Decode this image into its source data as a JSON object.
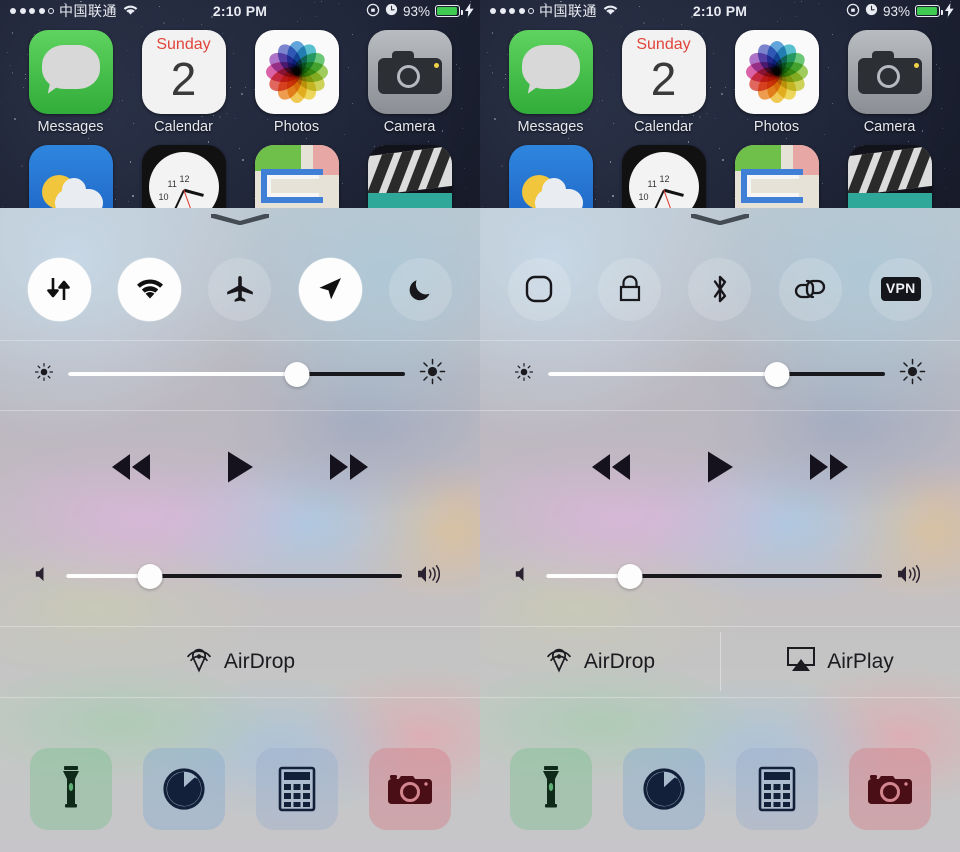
{
  "screens": [
    {
      "id": "left",
      "panel": "page-1"
    },
    {
      "id": "right",
      "panel": "page-2"
    }
  ],
  "status_bar": {
    "signal_dots_filled": 4,
    "signal_dots_total": 5,
    "carrier": "中国联通",
    "wifi_icon": "wifi-icon",
    "time": "2:10 PM",
    "rotation_lock_icon": "rotation-lock-icon",
    "alarm_icon": "alarm-clock-icon",
    "battery_percent": "93%",
    "battery_fill": 88,
    "battery_color": "#3fca52",
    "charging_icon": "lightning-bolt-icon"
  },
  "home_screen": {
    "rows": [
      [
        {
          "label": "Messages",
          "icon": "messages-icon"
        },
        {
          "label": "Calendar",
          "icon": "calendar-icon",
          "weekday": "Sunday",
          "date": "2"
        },
        {
          "label": "Photos",
          "icon": "photos-icon"
        },
        {
          "label": "Camera",
          "icon": "camera-icon"
        }
      ],
      [
        {
          "label": "Weather",
          "icon": "weather-icon"
        },
        {
          "label": "Clock",
          "icon": "clock-icon",
          "marks": [
            "10",
            "11",
            "12"
          ]
        },
        {
          "label": "Maps",
          "icon": "maps-icon"
        },
        {
          "label": "Videos",
          "icon": "videos-icon"
        }
      ]
    ]
  },
  "control_center": {
    "grabber": "grabber-handle",
    "left_toggles": [
      {
        "name": "cellular-data-toggle",
        "icon": "cellular-data-icon",
        "state": "on"
      },
      {
        "name": "wifi-toggle",
        "icon": "wifi-icon",
        "state": "on"
      },
      {
        "name": "airplane-mode-toggle",
        "icon": "airplane-icon",
        "state": "off"
      },
      {
        "name": "location-toggle",
        "icon": "location-arrow-icon",
        "state": "on"
      },
      {
        "name": "do-not-disturb-toggle",
        "icon": "moon-icon",
        "state": "off"
      }
    ],
    "right_toggles": [
      {
        "name": "assistive-touch-toggle",
        "icon": "rounded-square-icon",
        "state": "off"
      },
      {
        "name": "rotation-lock-toggle",
        "icon": "padlock-icon",
        "state": "off"
      },
      {
        "name": "bluetooth-toggle",
        "icon": "bluetooth-icon",
        "state": "off"
      },
      {
        "name": "personal-hotspot-toggle",
        "icon": "chain-link-icon",
        "state": "off"
      },
      {
        "name": "vpn-toggle",
        "icon": "vpn-badge-icon",
        "state": "off",
        "badge_text": "VPN"
      }
    ],
    "brightness": {
      "name": "brightness-slider",
      "min_icon": "small-sun-icon",
      "max_icon": "large-sun-icon",
      "value_percent": 68
    },
    "media": {
      "rewind_icon": "rewind-icon",
      "play_icon": "play-icon",
      "forward_icon": "fast-forward-icon"
    },
    "volume": {
      "name": "volume-slider",
      "min_icon": "speaker-mute-icon",
      "max_icon": "speaker-loud-icon",
      "value_percent": 25
    },
    "share_left": [
      {
        "label": "AirDrop",
        "icon": "airdrop-icon"
      }
    ],
    "share_right": [
      {
        "label": "AirDrop",
        "icon": "airdrop-icon"
      },
      {
        "label": "AirPlay",
        "icon": "airplay-icon"
      }
    ],
    "shortcuts": [
      {
        "name": "flashlight-shortcut",
        "icon": "flashlight-icon",
        "tint": "#7fbf92"
      },
      {
        "name": "timer-shortcut",
        "icon": "timer-icon",
        "tint": "#8aaecf"
      },
      {
        "name": "calculator-shortcut",
        "icon": "calculator-icon",
        "tint": "#9aaecd"
      },
      {
        "name": "camera-shortcut",
        "icon": "camera-icon",
        "tint": "#d4868f"
      }
    ]
  }
}
